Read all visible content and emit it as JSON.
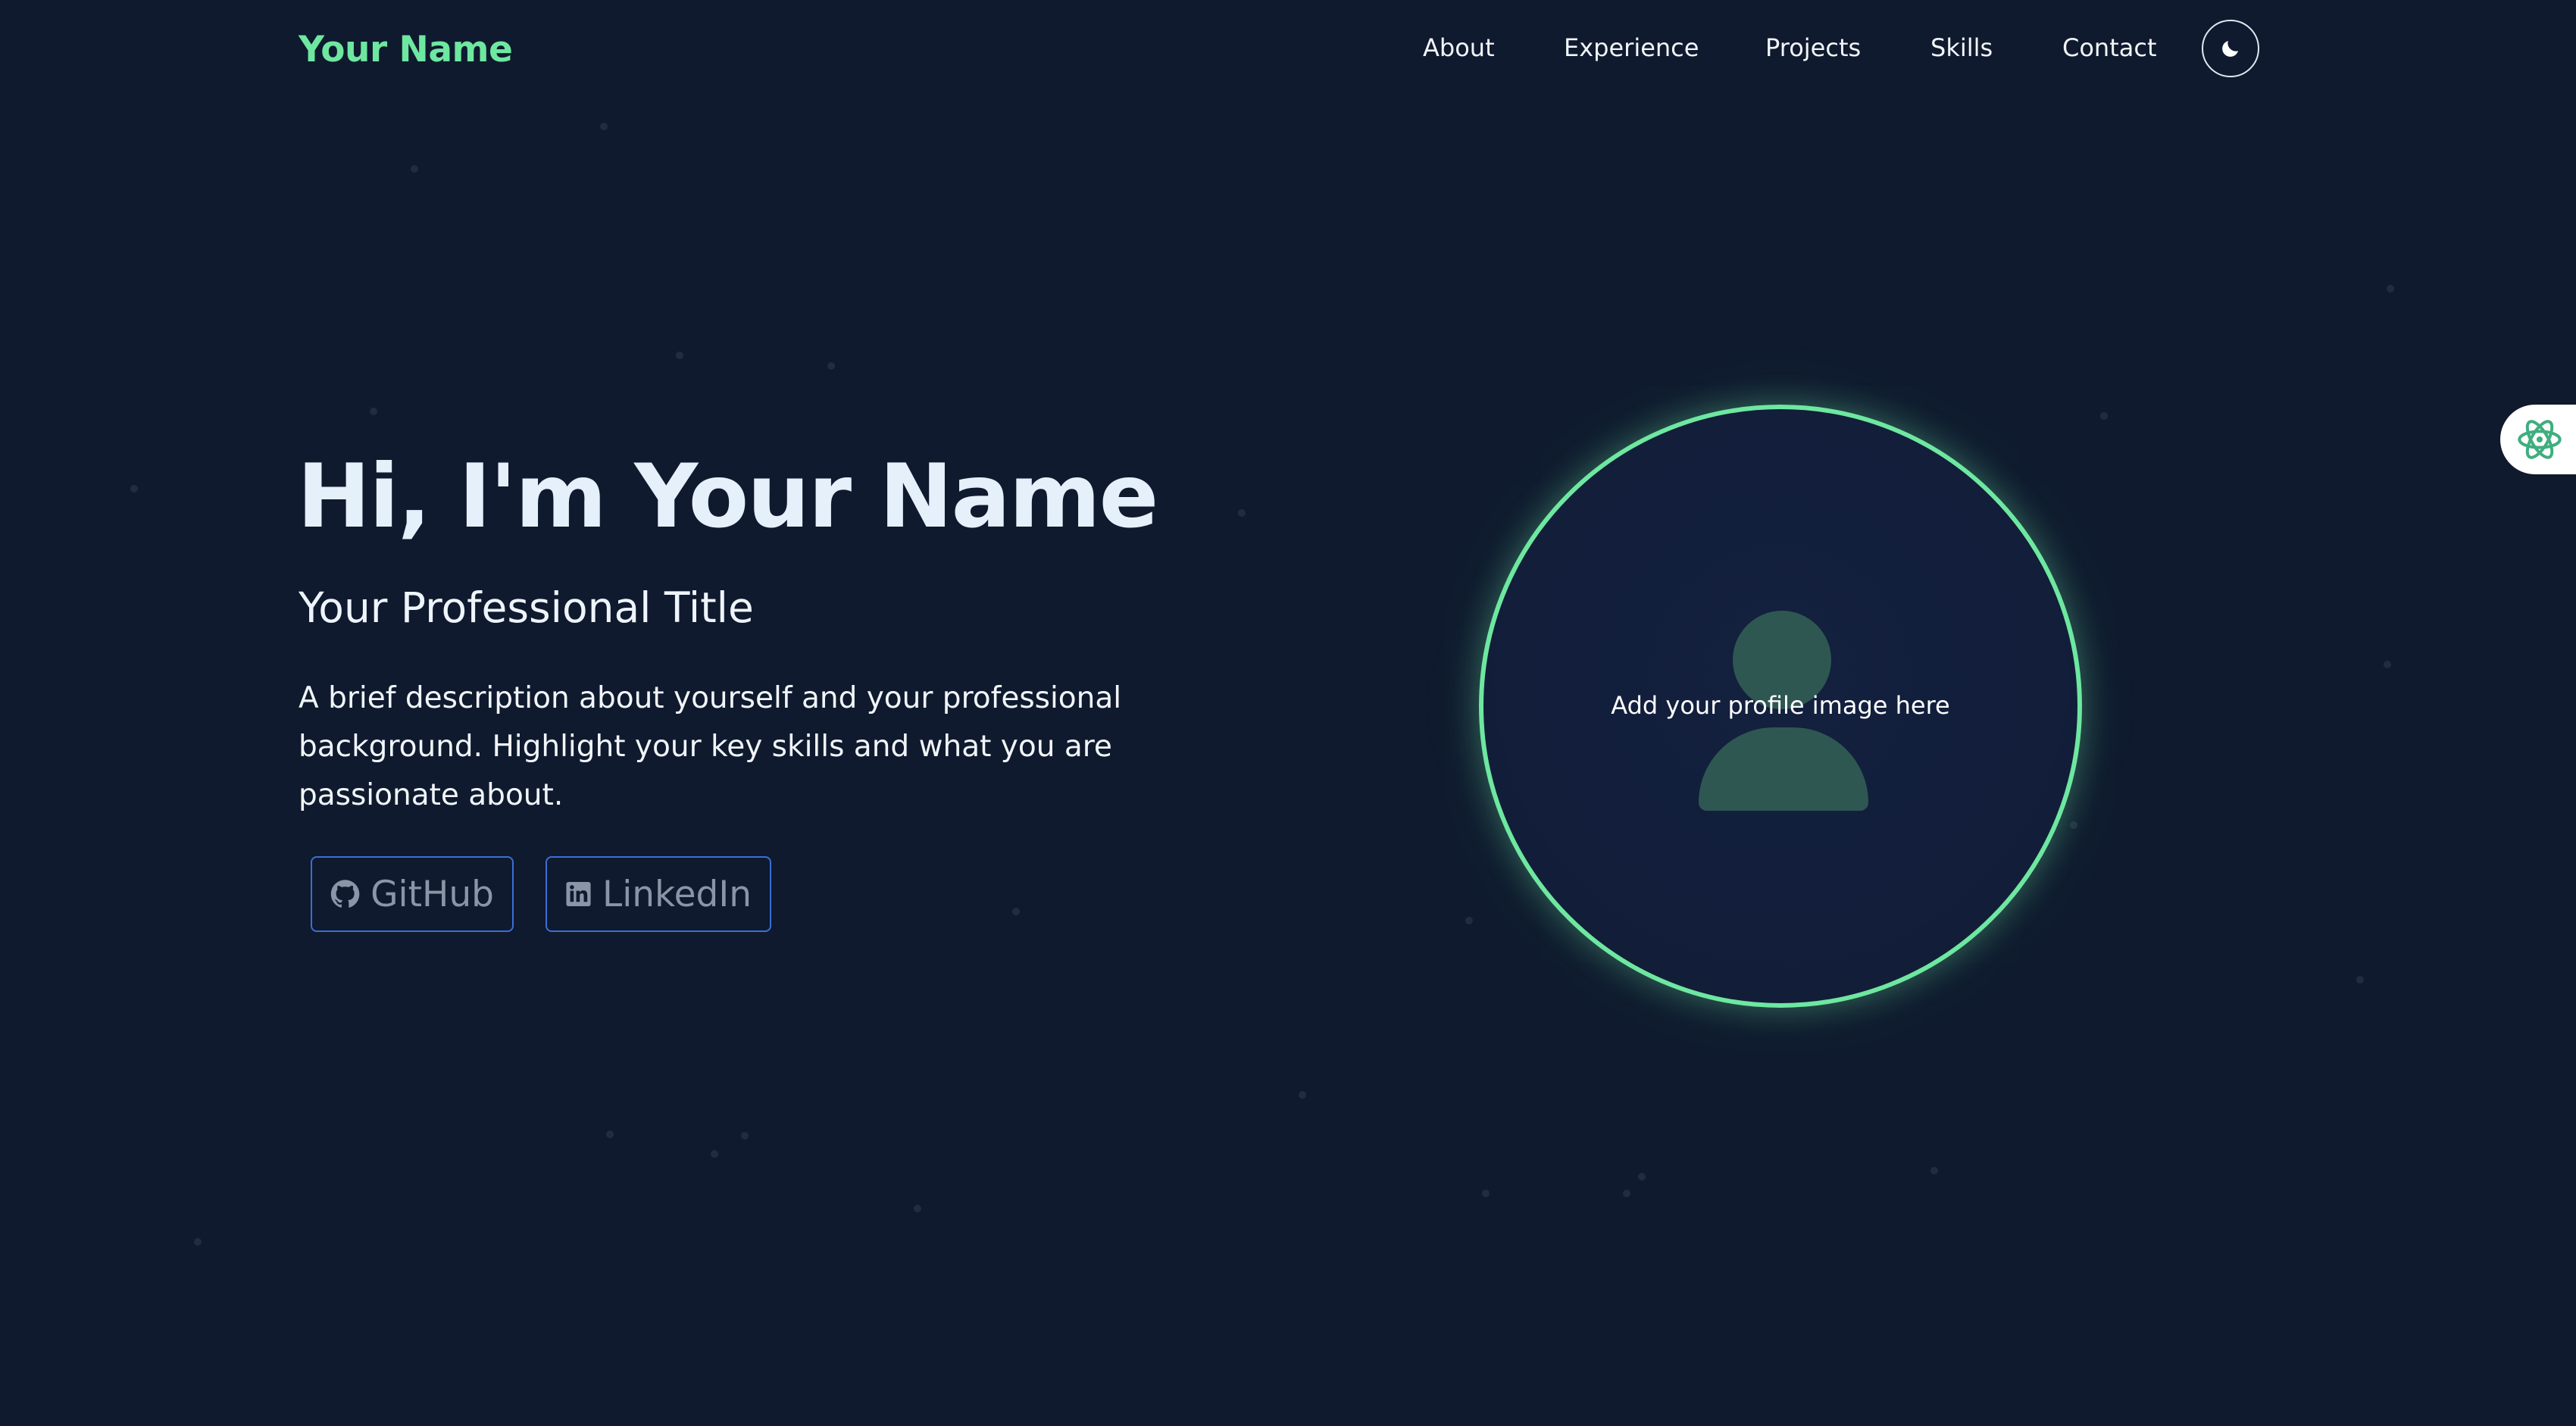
{
  "header": {
    "logo": "Your Name",
    "nav": [
      {
        "label": "About"
      },
      {
        "label": "Experience"
      },
      {
        "label": "Projects"
      },
      {
        "label": "Skills"
      },
      {
        "label": "Contact"
      }
    ],
    "theme_toggle_icon": "moon-icon"
  },
  "hero": {
    "title": "Hi, I'm Your Name",
    "subtitle": "Your Professional Title",
    "description": "A brief description about yourself and your professional background. Highlight your key skills and what you are passionate about.",
    "social": [
      {
        "label": "GitHub",
        "icon": "github-icon"
      },
      {
        "label": "LinkedIn",
        "icon": "linkedin-icon"
      }
    ]
  },
  "profile": {
    "placeholder_text": "Add your profile image here",
    "icon": "user-silhouette-icon"
  },
  "floating_widget": {
    "icon": "atom-icon"
  },
  "colors": {
    "background": "#0f1a2e",
    "accent": "#6ee7a0",
    "button_border": "#3b6fd6"
  }
}
